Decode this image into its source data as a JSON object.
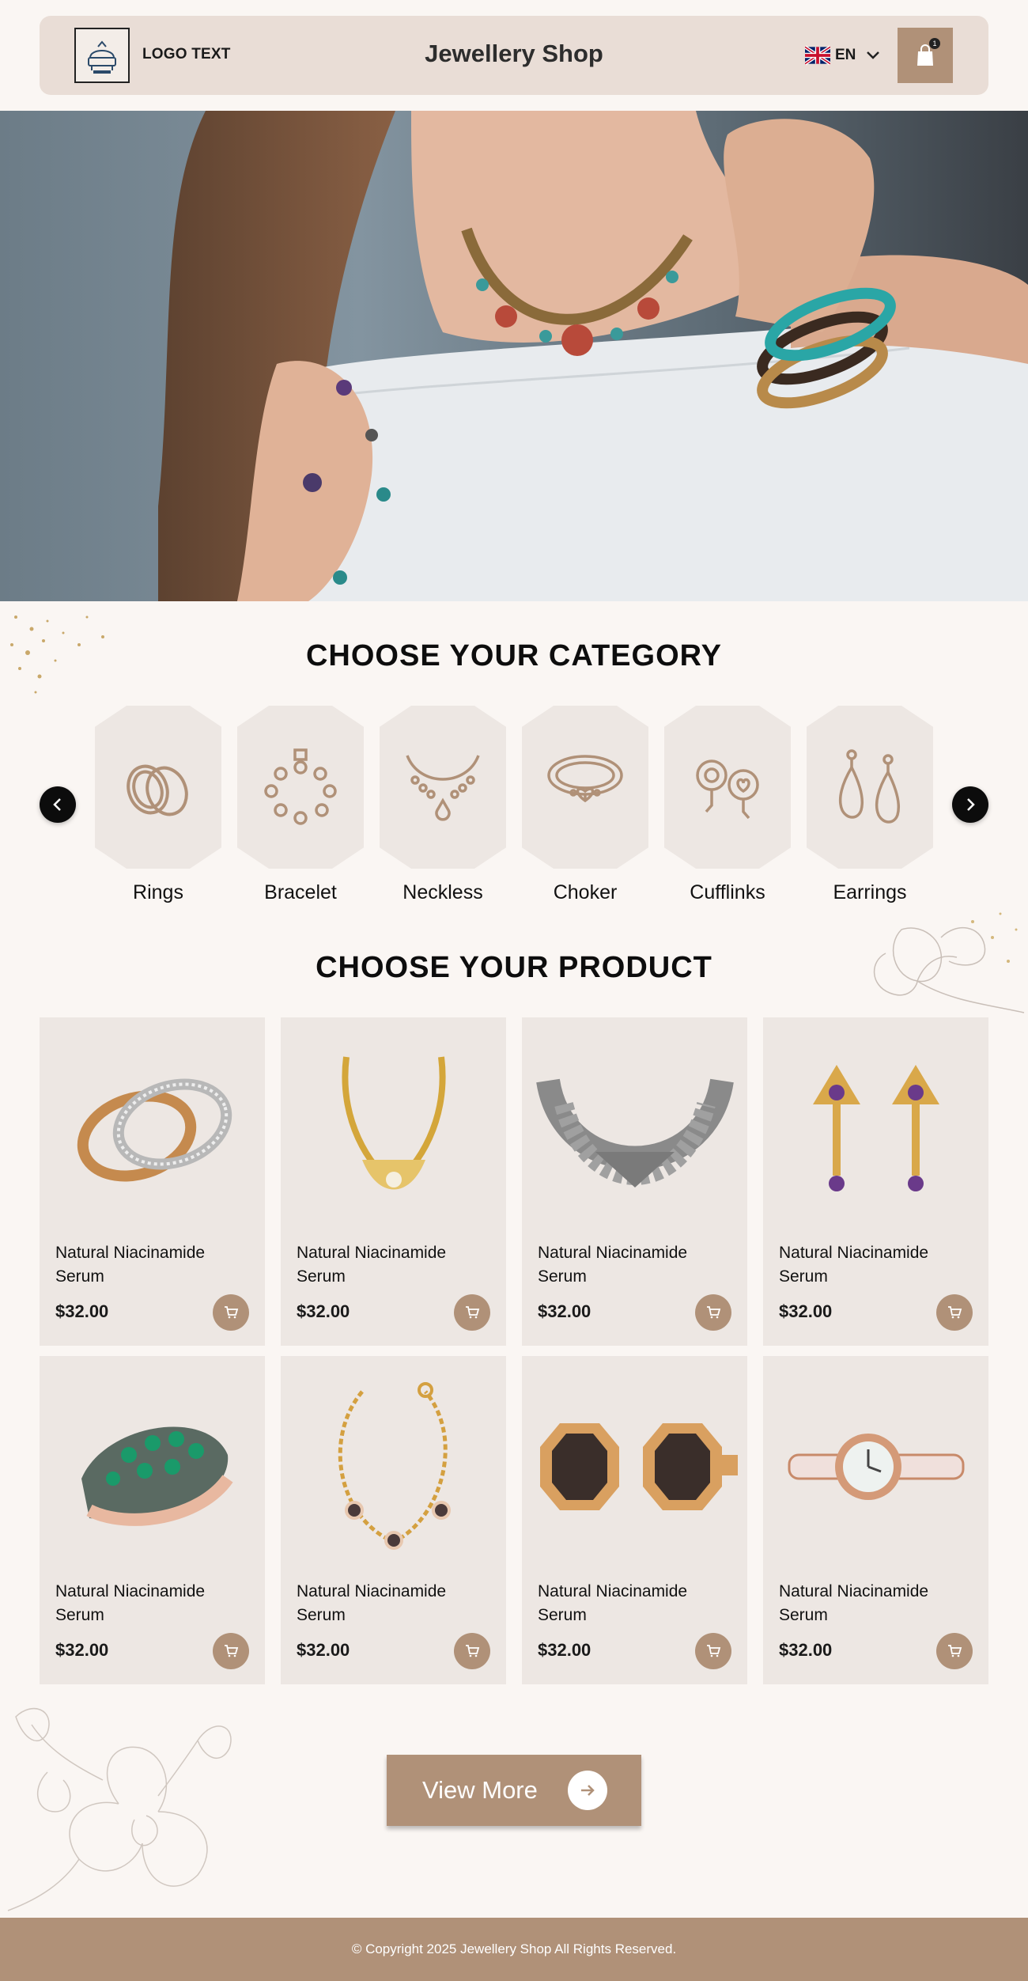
{
  "header": {
    "logo_text": "LOGO TEXT",
    "shop_title": "Jewellery Shop",
    "language": "EN",
    "cart_count": "1"
  },
  "hero": {
    "icon": "hero-photo-woman-with-jewellery"
  },
  "categories": {
    "title": "CHOOSE YOUR CATEGORY",
    "items": [
      {
        "label": "Rings",
        "icon": "rings-icon"
      },
      {
        "label": "Bracelet",
        "icon": "bracelet-icon"
      },
      {
        "label": "Neckless",
        "icon": "necklace-icon"
      },
      {
        "label": "Choker",
        "icon": "choker-icon"
      },
      {
        "label": "Cufflinks",
        "icon": "cufflinks-icon"
      },
      {
        "label": "Earrings",
        "icon": "earrings-icon"
      }
    ]
  },
  "products": {
    "title": "CHOOSE YOUR PRODUCT",
    "items": [
      {
        "name": "Natural Niacinamide Serum",
        "price": "$32.00",
        "image": "wedding-rings"
      },
      {
        "name": "Natural Niacinamide Serum",
        "price": "$32.00",
        "image": "gold-necklace"
      },
      {
        "name": "Natural Niacinamide Serum",
        "price": "$32.00",
        "image": "silver-choker"
      },
      {
        "name": "Natural Niacinamide Serum",
        "price": "$32.00",
        "image": "gold-earrings"
      },
      {
        "name": "Natural Niacinamide Serum",
        "price": "$32.00",
        "image": "emerald-bangle"
      },
      {
        "name": "Natural Niacinamide Serum",
        "price": "$32.00",
        "image": "gold-chain-bracelet"
      },
      {
        "name": "Natural Niacinamide Serum",
        "price": "$32.00",
        "image": "octagon-cufflinks"
      },
      {
        "name": "Natural Niacinamide Serum",
        "price": "$32.00",
        "image": "rose-gold-watch"
      }
    ]
  },
  "view_more": {
    "label": "View More"
  },
  "footer": {
    "copyright": "© Copyright 2025 Jewellery Shop All Rights Reserved."
  },
  "colors": {
    "accent": "#b09178",
    "header_bg": "#e9ddd6",
    "card_bg": "#ede7e3",
    "page_bg": "#faf6f3"
  }
}
